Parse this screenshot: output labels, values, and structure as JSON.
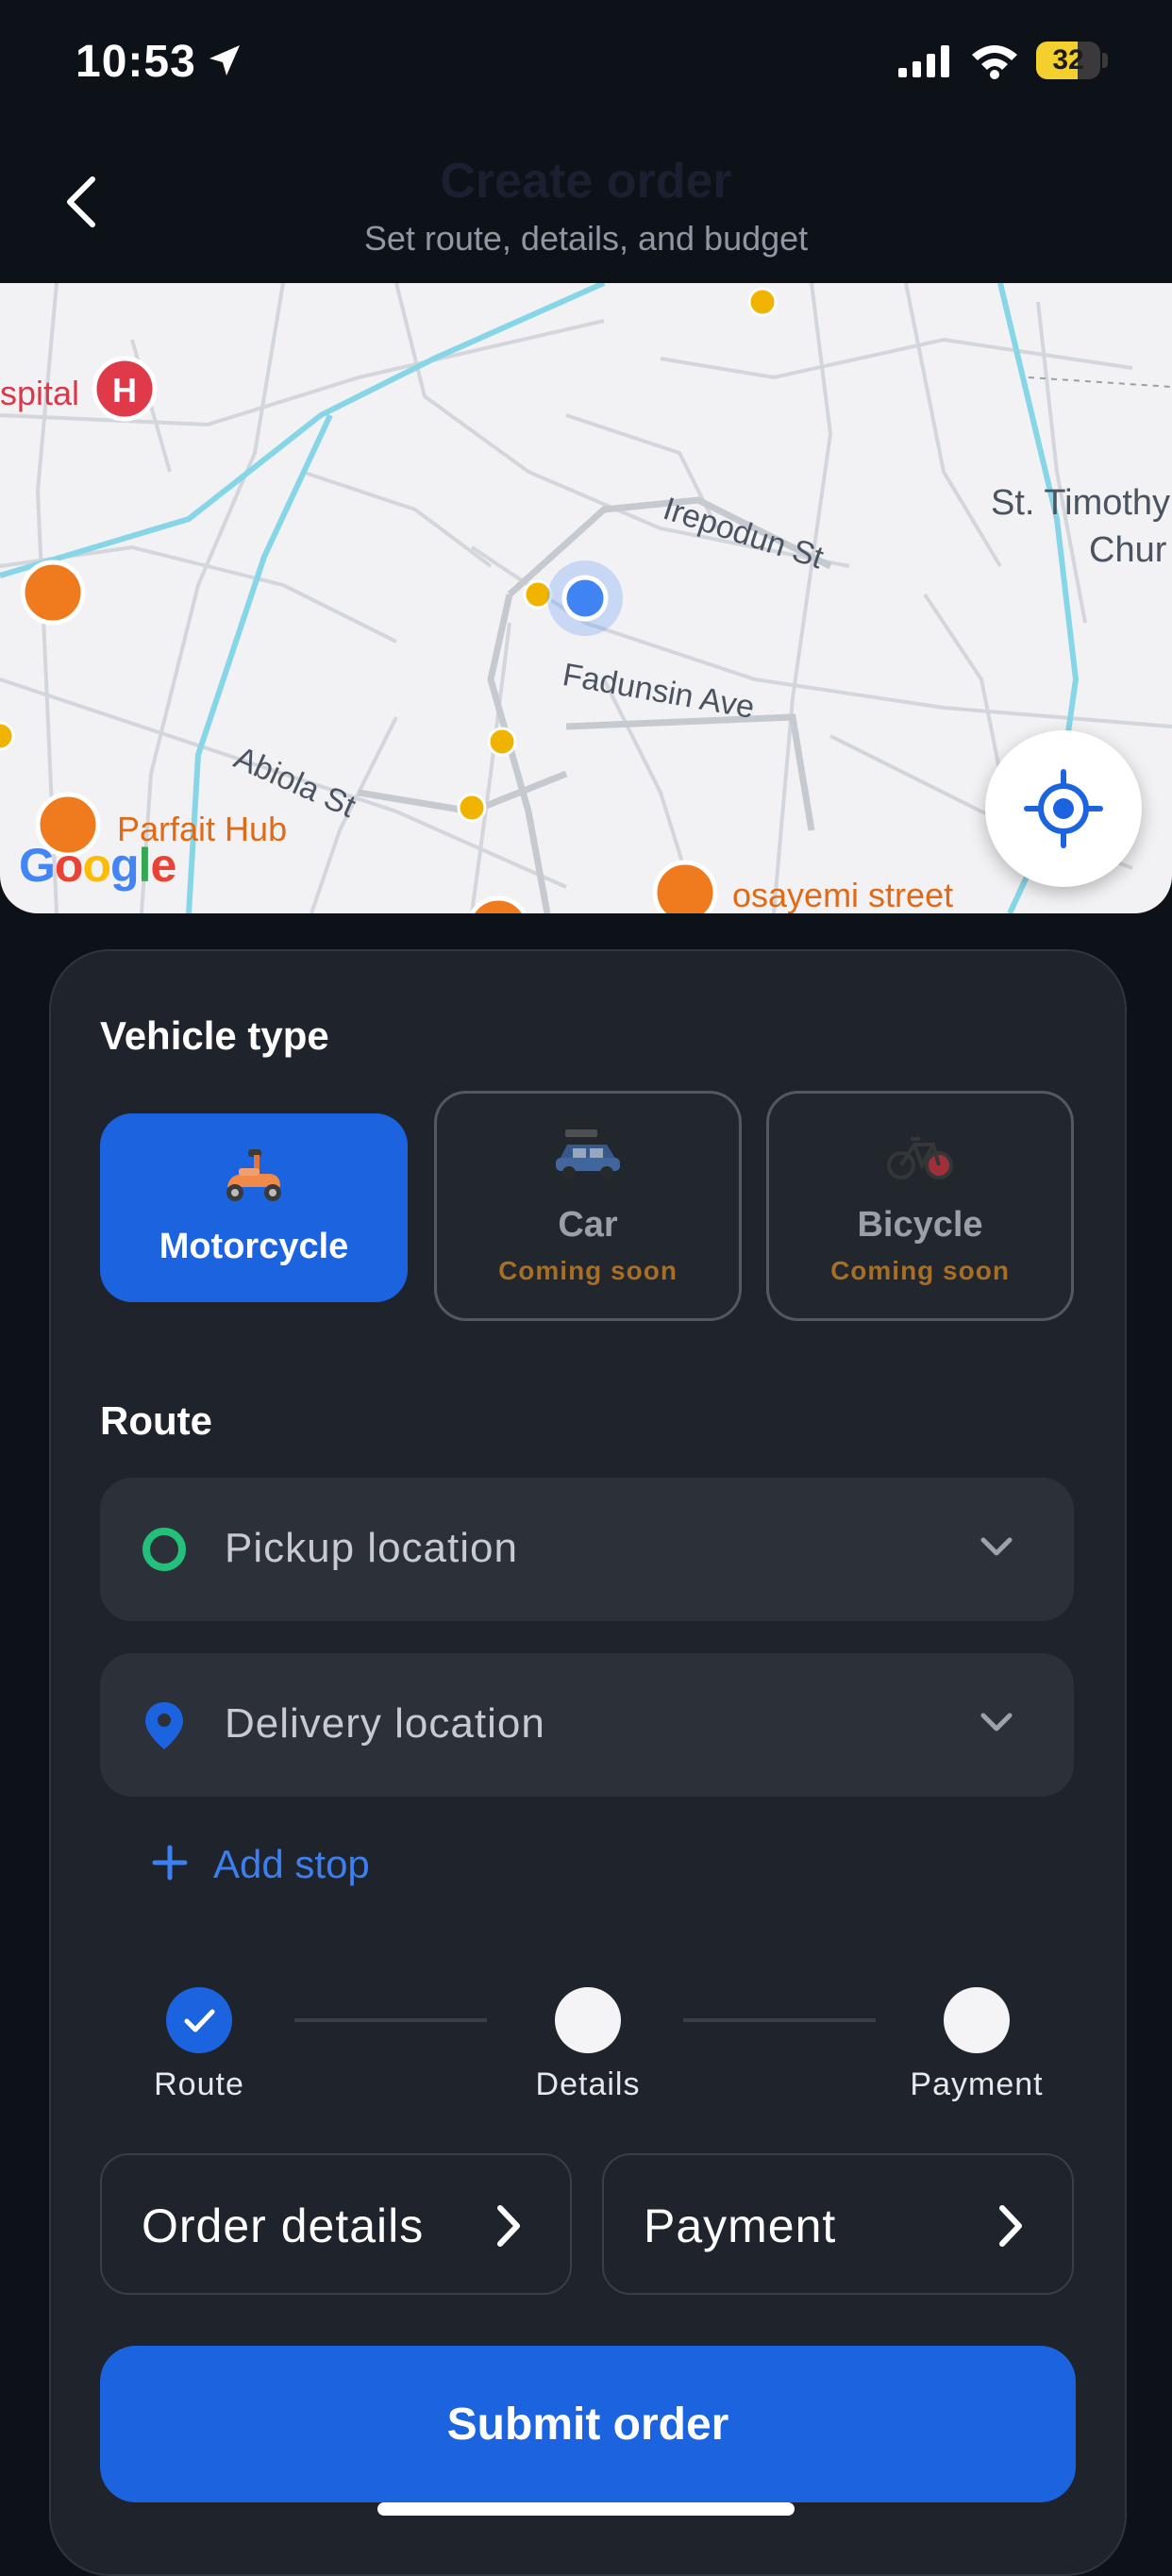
{
  "status_bar": {
    "time": "10:53",
    "battery": 32
  },
  "header": {
    "title": "Create order",
    "subtitle": "Set route, details, and budget"
  },
  "map": {
    "streets": [
      "Irepodun St",
      "Fadunsin Ave",
      "Abiola St"
    ],
    "places": {
      "hospital": "spital",
      "church_line1": "St. Timothy",
      "church_line2": "Chur",
      "restaurant": "Parfait Hub",
      "street_poi": "osayemi street"
    },
    "attribution": "Google"
  },
  "vehicle_section": {
    "title": "Vehicle type",
    "options": [
      {
        "name": "Motorcycle",
        "status": "",
        "selected": true
      },
      {
        "name": "Car",
        "status": "Coming soon",
        "selected": false
      },
      {
        "name": "Bicycle",
        "status": "Coming soon",
        "selected": false
      }
    ]
  },
  "route_section": {
    "title": "Route",
    "pickup_placeholder": "Pickup location",
    "delivery_placeholder": "Delivery location",
    "add_stop": "Add stop"
  },
  "stepper": {
    "steps": [
      {
        "label": "Route",
        "done": true
      },
      {
        "label": "Details",
        "done": false
      },
      {
        "label": "Payment",
        "done": false
      }
    ]
  },
  "actions": {
    "order_details": "Order details",
    "payment": "Payment",
    "submit": "Submit order"
  },
  "colors": {
    "accent": "#1c63e0",
    "background": "#0d1118",
    "card": "#1f232b",
    "field": "#2c3038",
    "pickup_ring": "#22c07a",
    "coming_soon": "#a76e25"
  }
}
